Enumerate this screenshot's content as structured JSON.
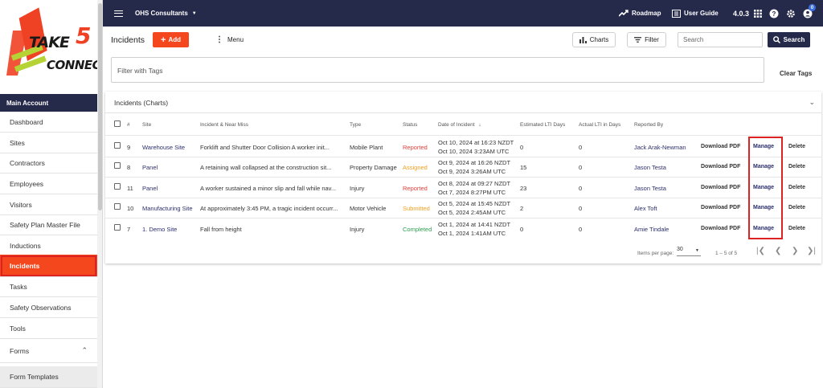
{
  "sidebar": {
    "logo": {
      "take": "TAKE",
      "five": "5",
      "connect": "CONNECT"
    },
    "section": "Main Account",
    "items": [
      {
        "label": "Dashboard"
      },
      {
        "label": "Sites"
      },
      {
        "label": "Contractors"
      },
      {
        "label": "Employees"
      },
      {
        "label": "Visitors"
      },
      {
        "label": "Safety Plan Master File"
      },
      {
        "label": "Inductions"
      },
      {
        "label": "Incidents",
        "active": true
      },
      {
        "label": "Tasks"
      },
      {
        "label": "Safety Observations"
      },
      {
        "label": "Tools"
      },
      {
        "label": "Forms"
      },
      {
        "label": "Form Templates"
      }
    ]
  },
  "topbar": {
    "org": "OHS Consultants",
    "roadmap": "Roadmap",
    "user_guide": "User Guide",
    "version": "4.0.3",
    "notification_count": "0"
  },
  "header": {
    "title": "Incidents",
    "add_label": "Add",
    "menu_label": "Menu",
    "charts_label": "Charts",
    "filter_label": "Filter",
    "search_placeholder": "Search",
    "search_button": "Search",
    "tags_placeholder": "Filter with Tags",
    "clear_tags": "Clear Tags"
  },
  "charts_panel": {
    "label": "Incidents (Charts)"
  },
  "table": {
    "columns": {
      "num": "#",
      "site": "Site",
      "incident": "Incident & Near Miss",
      "type": "Type",
      "status": "Status",
      "date": "Date of Incident",
      "est_lti": "Estimated LTI Days",
      "actual_lti": "Actual LTI in Days",
      "reporter": "Reported By"
    },
    "rows": [
      {
        "num": "9",
        "site": "Warehouse Site",
        "incident": "Forklift and Shutter Door Collision A worker init...",
        "type": "Mobile Plant",
        "status": "Reported",
        "date1": "Oct 10, 2024 at 16:23 NZDT",
        "date2": "Oct 10, 2024 3:23AM UTC",
        "est": "0",
        "act": "0",
        "reporter": "Jack Arak-Newman",
        "download": "Download PDF",
        "manage": "Manage",
        "delete": "Delete"
      },
      {
        "num": "8",
        "site": "Panel",
        "incident": "A retaining wall collapsed at the construction sit...",
        "type": "Property Damage",
        "status": "Assigned",
        "date1": "Oct 9, 2024 at 16:26 NZDT",
        "date2": "Oct 9, 2024 3:26AM UTC",
        "est": "15",
        "act": "0",
        "reporter": "Jason Testa",
        "download": "Download PDF",
        "manage": "Manage",
        "delete": "Delete"
      },
      {
        "num": "11",
        "site": "Panel",
        "incident": "A worker sustained a minor slip and fall while nav...",
        "type": "Injury",
        "status": "Reported",
        "date1": "Oct 8, 2024 at 09:27 NZDT",
        "date2": "Oct 7, 2024 8:27PM UTC",
        "est": "23",
        "act": "0",
        "reporter": "Jason Testa",
        "download": "Download PDF",
        "manage": "Manage",
        "delete": "Delete"
      },
      {
        "num": "10",
        "site": "Manufacturing Site",
        "incident": "At approximately 3:45 PM, a tragic incident occurr...",
        "type": "Motor Vehicle",
        "status": "Submitted",
        "date1": "Oct 5, 2024 at 15:45 NZDT",
        "date2": "Oct 5, 2024 2:45AM UTC",
        "est": "2",
        "act": "0",
        "reporter": "Alex Toft",
        "download": "Download PDF",
        "manage": "Manage",
        "delete": "Delete"
      },
      {
        "num": "7",
        "site": "1. Demo Site",
        "incident": "Fall from height",
        "type": "Injury",
        "status": "Completed",
        "date1": "Oct 1, 2024 at 14:41 NZDT",
        "date2": "Oct 1, 2024 1:41AM UTC",
        "est": "0",
        "act": "0",
        "reporter": "Amie Tindale",
        "download": "Download PDF",
        "manage": "Manage",
        "delete": "Delete"
      }
    ]
  },
  "pagination": {
    "items_per_page_label": "Items per page:",
    "items_per_page": "30",
    "range": "1 – 5 of 5"
  },
  "colors": {
    "navy": "#25294a",
    "accent_orange": "#f4471d",
    "highlight_red": "#dd2222"
  }
}
